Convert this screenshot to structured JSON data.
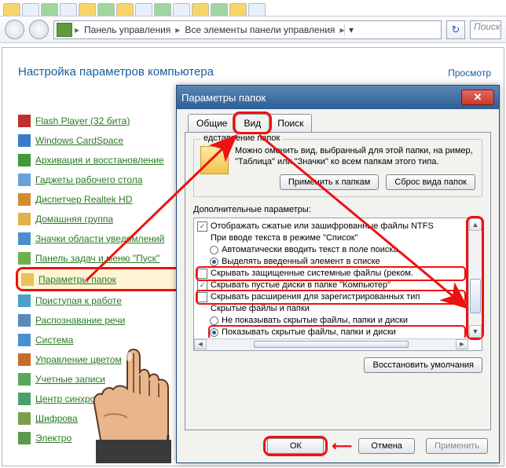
{
  "addressbar": {
    "crumb1": "Панель управления",
    "crumb2": "Все элементы панели управления",
    "search_placeholder": "Поиск"
  },
  "panel": {
    "title": "Настройка параметров компьютера",
    "rightlink": "Просмотр"
  },
  "cp_items": [
    {
      "label": "Flash Player (32 бита)",
      "icon": "#c03028"
    },
    {
      "label": "Windows CardSpace",
      "icon": "#3a7cc8"
    },
    {
      "label": "Архивация и восстановление",
      "icon": "#3e9a3a"
    },
    {
      "label": "Гаджеты рабочего стола",
      "icon": "#6aa0d8"
    },
    {
      "label": "Диспетчер Realtek HD",
      "icon": "#d48b2e"
    },
    {
      "label": "Домашняя группа",
      "icon": "#e0b24a"
    },
    {
      "label": "Значки области уведомлений",
      "icon": "#4a8ed0"
    },
    {
      "label": "Панель задач и меню \"Пуск\"",
      "icon": "#6fb04e"
    },
    {
      "label": "Параметры папок",
      "icon": "#e8c25a",
      "hl": true
    },
    {
      "label": "Приступая к работе",
      "icon": "#4aa0c8"
    },
    {
      "label": "Распознавание речи",
      "icon": "#5a88c0"
    },
    {
      "label": "Система",
      "icon": "#4a90d0"
    },
    {
      "label": "Управление цветом",
      "icon": "#c86a2a"
    },
    {
      "label": "Учетные записи",
      "icon": "#5aa85a"
    },
    {
      "label": "Центр синхро",
      "icon": "#4aa06a"
    },
    {
      "label": "Шифрова",
      "icon": "#7aa04a"
    },
    {
      "label": "Электро",
      "icon": "#5a9a4a"
    }
  ],
  "dialog": {
    "title": "Параметры папок",
    "tabs": {
      "general": "Общие",
      "view": "Вид",
      "search": "Поиск"
    },
    "group_legend": "едставление папок",
    "group_text": "Можно оменить вид, выбранный для этой папки, на ример, \"Таблица\" или \"Значки\" ко всем папкам этого типа.",
    "btn_apply_to": "Применить к папкам",
    "btn_reset_view": "Сброс вида папок",
    "adv_label": "Дополнительные параметры:",
    "rows": [
      {
        "type": "cb",
        "checked": true,
        "indent": 0,
        "text": "Отображать сжатые или зашифрованные файлы NTFS"
      },
      {
        "type": "label",
        "indent": 0,
        "text": "При вводе текста в режиме \"Список\""
      },
      {
        "type": "rb",
        "checked": false,
        "indent": 1,
        "text": "Автоматически вводить текст в поле поиска"
      },
      {
        "type": "rb",
        "checked": true,
        "indent": 1,
        "text": "Выделять введенный элемент в списке"
      },
      {
        "type": "cb",
        "checked": false,
        "indent": 0,
        "hl": true,
        "text": "Скрывать защищенные системные файлы (реком."
      },
      {
        "type": "cb",
        "checked": true,
        "indent": 0,
        "text": "Скрывать пустые диски в папке \"Компьютер\""
      },
      {
        "type": "cb",
        "checked": false,
        "indent": 0,
        "hl": true,
        "text": "Скрывать расширения для зарегистрированных тип"
      },
      {
        "type": "label",
        "indent": 0,
        "text": "Скрытые файлы и папки"
      },
      {
        "type": "rb",
        "checked": false,
        "indent": 1,
        "text": "Не показывать скрытые файлы, папки и диски"
      },
      {
        "type": "rb",
        "checked": true,
        "indent": 1,
        "hl": true,
        "text": "Показывать скрытые файлы, папки и диски"
      }
    ],
    "btn_restore": "Восстановить умолчания",
    "btn_ok": "ОК",
    "btn_cancel": "Отмена",
    "btn_apply": "Применить"
  }
}
